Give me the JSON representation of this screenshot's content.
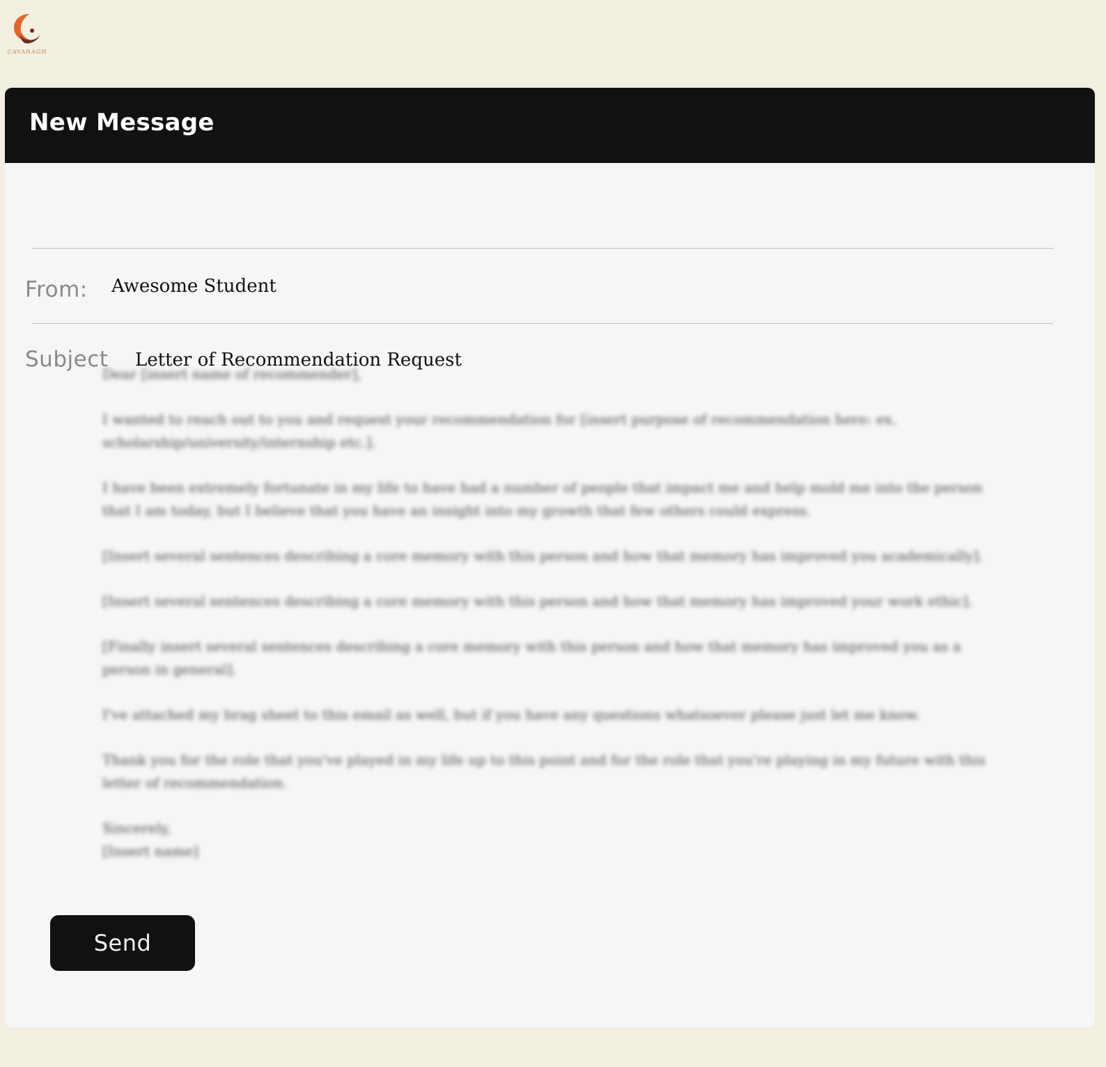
{
  "brand": {
    "logo_text": "CAVANAGH",
    "colors": {
      "background": "#f3efe1",
      "header": "#111111",
      "card": "#f6f6f6",
      "logo_orange": "#e0662e",
      "logo_brown": "#6b2a2a"
    }
  },
  "compose": {
    "title": "New Message",
    "from_label": "From:",
    "from_value": "Awesome Student",
    "subject_label": "Subject",
    "subject_value": "Letter of Recommendation Request",
    "body": [
      "Dear [insert name of recommender],",
      "I wanted to reach out to you and request your recommendation for [insert purpose of recommendation here: ex. scholarship/university/internship etc.].",
      "I have been extremely fortunate in my life to have had a number of people that impact me and help mold me into the person that I am today, but I believe that you have an insight into my growth that few others could express.",
      "[Insert several sentences describing a core memory with this person and how that memory has improved you academically].",
      "[Insert several sentences describing a core memory with this person and how that memory has improved your work ethic].",
      "[Finally insert several sentences describing a core memory with this person and how that memory has improved you as a person in general].",
      "I've attached my brag sheet to this email as well, but if you have any questions whatsoever please just let me know.",
      "Thank you for the role that you've played in my life up to this point and for the role that you're playing in my future with this letter of recommendation.",
      "Sincerely,\n[Insert name]"
    ],
    "send_label": "Send"
  }
}
